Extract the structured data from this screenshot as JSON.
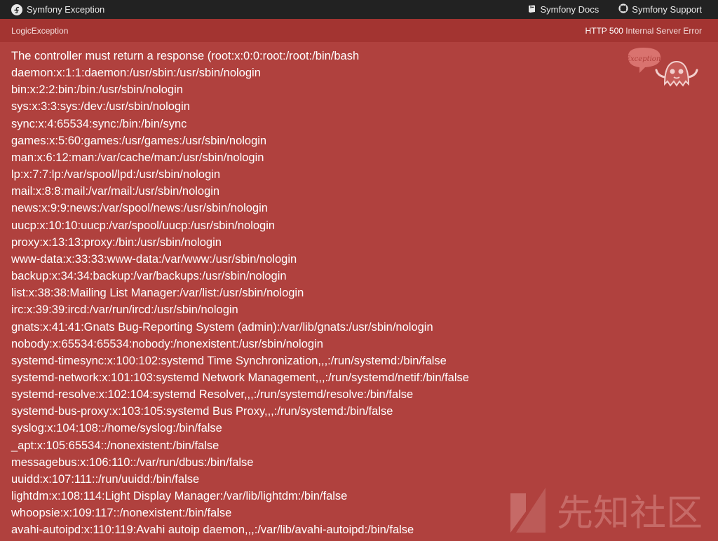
{
  "topbar": {
    "brand": "Symfony Exception",
    "links": [
      "Symfony Docs",
      "Symfony Support"
    ]
  },
  "subbar": {
    "exception_class": "LogicException",
    "http_code": "HTTP 500",
    "http_text": "Internal Server Error"
  },
  "mascot": {
    "bubble_text": "Exception!"
  },
  "message_lines": [
    "The controller must return a response (root:x:0:0:root:/root:/bin/bash",
    "daemon:x:1:1:daemon:/usr/sbin:/usr/sbin/nologin",
    "bin:x:2:2:bin:/bin:/usr/sbin/nologin",
    "sys:x:3:3:sys:/dev:/usr/sbin/nologin",
    "sync:x:4:65534:sync:/bin:/bin/sync",
    "games:x:5:60:games:/usr/games:/usr/sbin/nologin",
    "man:x:6:12:man:/var/cache/man:/usr/sbin/nologin",
    "lp:x:7:7:lp:/var/spool/lpd:/usr/sbin/nologin",
    "mail:x:8:8:mail:/var/mail:/usr/sbin/nologin",
    "news:x:9:9:news:/var/spool/news:/usr/sbin/nologin",
    "uucp:x:10:10:uucp:/var/spool/uucp:/usr/sbin/nologin",
    "proxy:x:13:13:proxy:/bin:/usr/sbin/nologin",
    "www-data:x:33:33:www-data:/var/www:/usr/sbin/nologin",
    "backup:x:34:34:backup:/var/backups:/usr/sbin/nologin",
    "list:x:38:38:Mailing List Manager:/var/list:/usr/sbin/nologin",
    "irc:x:39:39:ircd:/var/run/ircd:/usr/sbin/nologin",
    "gnats:x:41:41:Gnats Bug-Reporting System (admin):/var/lib/gnats:/usr/sbin/nologin",
    "nobody:x:65534:65534:nobody:/nonexistent:/usr/sbin/nologin",
    "systemd-timesync:x:100:102:systemd Time Synchronization,,,:/run/systemd:/bin/false",
    "systemd-network:x:101:103:systemd Network Management,,,:/run/systemd/netif:/bin/false",
    "systemd-resolve:x:102:104:systemd Resolver,,,:/run/systemd/resolve:/bin/false",
    "systemd-bus-proxy:x:103:105:systemd Bus Proxy,,,:/run/systemd:/bin/false",
    "syslog:x:104:108::/home/syslog:/bin/false",
    "_apt:x:105:65534::/nonexistent:/bin/false",
    "messagebus:x:106:110::/var/run/dbus:/bin/false",
    "uuidd:x:107:111::/run/uuidd:/bin/false",
    "lightdm:x:108:114:Light Display Manager:/var/lib/lightdm:/bin/false",
    "whoopsie:x:109:117::/nonexistent:/bin/false",
    "avahi-autoipd:x:110:119:Avahi autoip daemon,,,:/var/lib/avahi-autoipd:/bin/false"
  ],
  "watermark": {
    "text": "先知社区"
  },
  "icons": {
    "brand": "symfony-logo-icon",
    "docs": "book-icon",
    "support": "lifebuoy-icon"
  },
  "colors": {
    "topbar_bg": "#222222",
    "page_bg": "#b0413e",
    "subbar_bg": "#a33431",
    "text": "#ffffff"
  }
}
